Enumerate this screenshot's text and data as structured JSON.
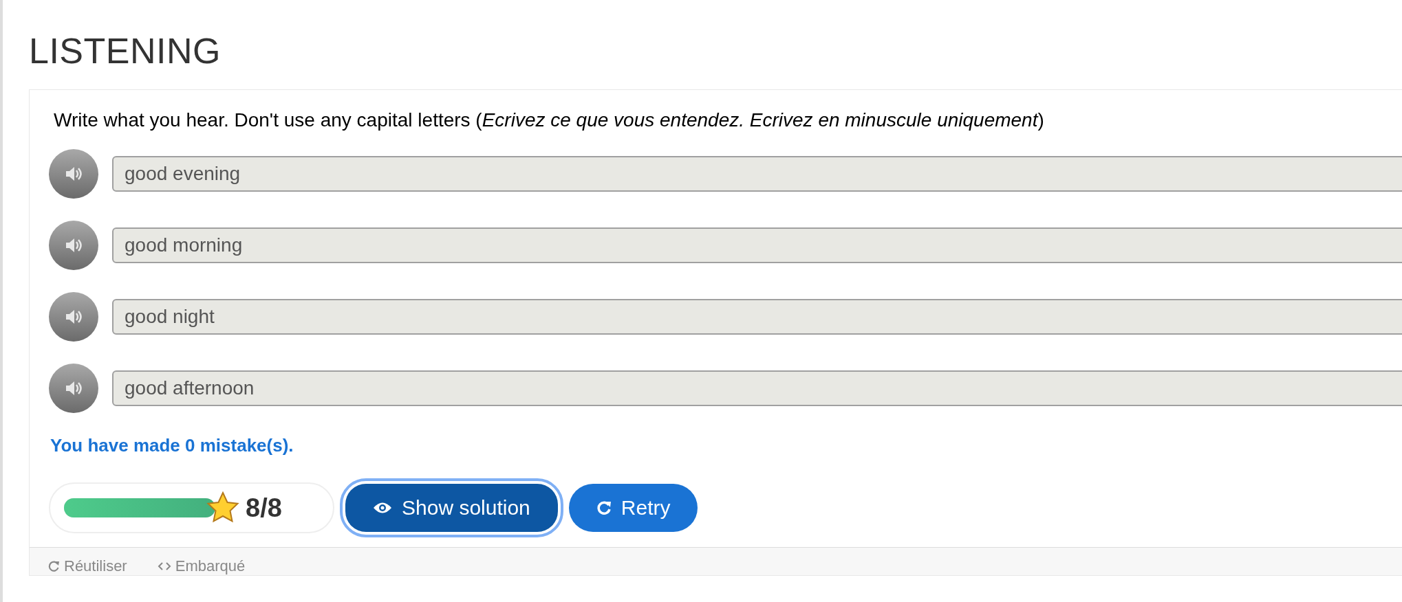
{
  "title": "LISTENING",
  "instruction": "Write what you hear. Don't use any capital letters (*Ecrivez ce que vous entendez. Ecrivez en minuscule uniquement*)",
  "items": [
    {
      "value": "good evening",
      "disabled": true
    },
    {
      "value": "good morning",
      "disabled": true
    },
    {
      "value": "good night",
      "disabled": true
    },
    {
      "value": "good afternoon",
      "disabled": true
    }
  ],
  "feedback": "You have made 0 mistake(s).",
  "score": {
    "level": 1,
    "text": "8/8"
  },
  "buttons": [
    {
      "kind": "show",
      "label": "Show solution",
      "focused": true
    },
    {
      "kind": "retry",
      "label": "Retry",
      "focused": false
    }
  ],
  "footer": [
    {
      "kind": "reuse",
      "label": "Réutiliser"
    },
    {
      "kind": "embed",
      "label": "Embarqué"
    }
  ]
}
